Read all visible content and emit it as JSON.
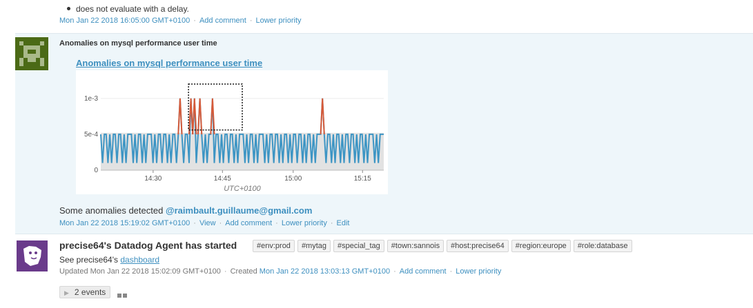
{
  "top_event": {
    "bullet_text": "does not evaluate with a delay.",
    "timestamp": "Mon Jan 22 2018 16:05:00 GMT+0100",
    "actions": [
      "Add comment",
      "Lower priority"
    ]
  },
  "anomaly_event": {
    "title": "Anomalies on mysql performance user time",
    "graph_title": "Anomalies on mysql performance user time",
    "text_prefix": "Some anomalies detected",
    "mention": "@raimbault.guillaume@gmail.com",
    "timestamp": "Mon Jan 22 2018 15:19:02 GMT+0100",
    "actions": [
      "View",
      "Add comment",
      "Lower priority",
      "Edit"
    ]
  },
  "chart_data": {
    "type": "line",
    "title": "",
    "xlabel": "UTC+0100",
    "ylabel": "",
    "x_ticks": [
      "14:30",
      "14:45",
      "15:00",
      "15:15"
    ],
    "y_ticks": [
      "0",
      "5e-4",
      "1e-3"
    ],
    "ylim": [
      0,
      0.0012
    ],
    "xlim_minutes": [
      14.333,
      15.333
    ],
    "colors": {
      "normal": "#3d95c4",
      "anomaly": "#d65b3a",
      "band": "#e2e2e2"
    },
    "series": [
      {
        "values": [
          0.0005,
          0.0001,
          0.0005,
          0.0005,
          0.0001,
          0.0005,
          0.0001,
          0.0005,
          0.0005,
          0.0001,
          0.0005,
          0.0005,
          0.0001,
          0.0005,
          0.0001,
          0.0005,
          0.0005,
          0.0005,
          0.0001,
          0.0005,
          0.0001,
          0.0005,
          0.0005,
          0.0001,
          0.0005,
          0.0001,
          0.0005,
          0.0005,
          0.0005,
          0.0001,
          0.0005,
          0.0001,
          0.0005,
          0.0005,
          0.0001,
          0.0005,
          0.0005,
          0.0001,
          0.0005,
          0.0001,
          0.0005,
          0.0005,
          0.0001,
          0.0005,
          0.001,
          0.0005,
          0.0001,
          0.0005,
          0.0005,
          0.0001,
          0.001,
          0.0005,
          0.001,
          0.0001,
          0.0005,
          0.001,
          0.0005,
          0.0001,
          0.0005,
          0.0001,
          0.0005,
          0.0005,
          0.001,
          0.0001,
          0.0005,
          0.0005,
          0.0001,
          0.0005,
          0.0001,
          0.0005,
          0.0005,
          0.0001,
          0.0005,
          0.0005,
          0.0001,
          0.0005,
          0.0001,
          0.0005,
          0.0005,
          0.0005,
          0.0001,
          0.0005,
          0.0001,
          0.0005,
          0.0005,
          0.0001,
          0.0005,
          0.0001,
          0.0005,
          0.0005,
          0.0005,
          0.0001,
          0.0005,
          0.0001,
          0.0005,
          0.0005,
          0.0001,
          0.0005,
          0.0005,
          0.0001,
          0.0005,
          0.0001,
          0.0005,
          0.0005,
          0.0001,
          0.0005,
          0.0001,
          0.0005,
          0.0005,
          0.0001,
          0.0005,
          0.0005,
          0.0001,
          0.0005,
          0.0001,
          0.0005,
          0.0005,
          0.0001,
          0.0005,
          0.0001,
          0.0005,
          0.0005,
          0.0005,
          0.001,
          0.0005,
          0.0001,
          0.0005,
          0.0005,
          0.0001,
          0.0005,
          0.0001,
          0.0005,
          0.0005,
          0.0001,
          0.0005,
          0.0001,
          0.0005,
          0.0005,
          0.0001,
          0.0005,
          0.0005,
          0.0001,
          0.0005,
          0.0001,
          0.0005,
          0.0005,
          0.0001,
          0.0005,
          0.0001,
          0.0005,
          0.0005,
          0.0005,
          0.0001,
          0.0005,
          0.0001,
          0.0005,
          0.0005,
          0.0005
        ]
      }
    ],
    "anomaly_threshold": 0.0005,
    "highlight_box": {
      "x_start_frac": 0.31,
      "x_end_frac": 0.5
    }
  },
  "agent_event": {
    "title": "precise64's Datadog Agent has started",
    "tags": [
      "#env:prod",
      "#mytag",
      "#special_tag",
      "#town:sannois",
      "#host:precise64",
      "#region:europe",
      "#role:database"
    ],
    "see_prefix": "See precise64's",
    "see_link": "dashboard",
    "updated": "Updated Mon Jan 22 2018 15:02:09 GMT+0100",
    "created_label": "Created",
    "created_ts": "Mon Jan 22 2018 13:03:13 GMT+0100",
    "actions": [
      "Add comment",
      "Lower priority"
    ],
    "events_label": "2 events"
  }
}
